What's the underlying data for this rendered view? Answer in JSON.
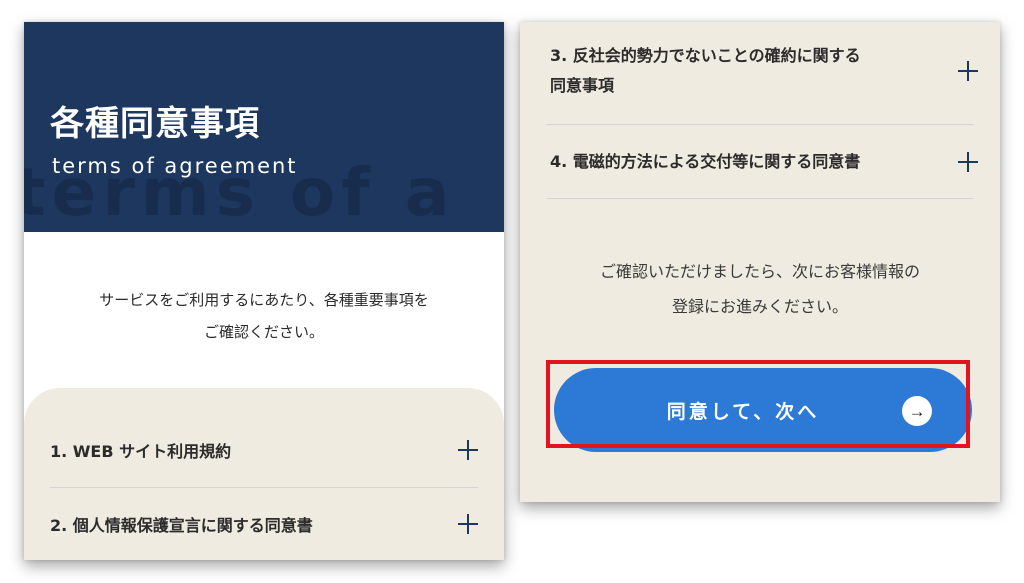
{
  "left_panel": {
    "hero": {
      "title": "各種同意事項",
      "subtitle": "terms of agreement",
      "watermark": "terms of a"
    },
    "intro_lines": [
      "サービスをご利用するにあたり、各種重要事項を",
      "ご確認ください。"
    ],
    "items": [
      {
        "label": "1. WEB サイト利用規約"
      },
      {
        "label": "2. 個人情報保護宣言に関する同意書"
      }
    ]
  },
  "right_panel": {
    "items": [
      {
        "label_lines": [
          "3. 反社会的勢力でないことの確約に関する",
          "同意事項"
        ]
      },
      {
        "label_lines": [
          "4. 電磁的方法による交付等に関する同意書"
        ]
      }
    ],
    "confirm_lines": [
      "ご確認いただけましたら、次にお客様情報の",
      "登録にお進みください。"
    ],
    "cta": {
      "label": "同意して、次へ",
      "arrow_icon": "→"
    }
  },
  "colors": {
    "navy": "#1e375f",
    "beige": "#efebe0",
    "cta_blue": "#2d7ad6",
    "highlight_red": "#e3141f"
  }
}
